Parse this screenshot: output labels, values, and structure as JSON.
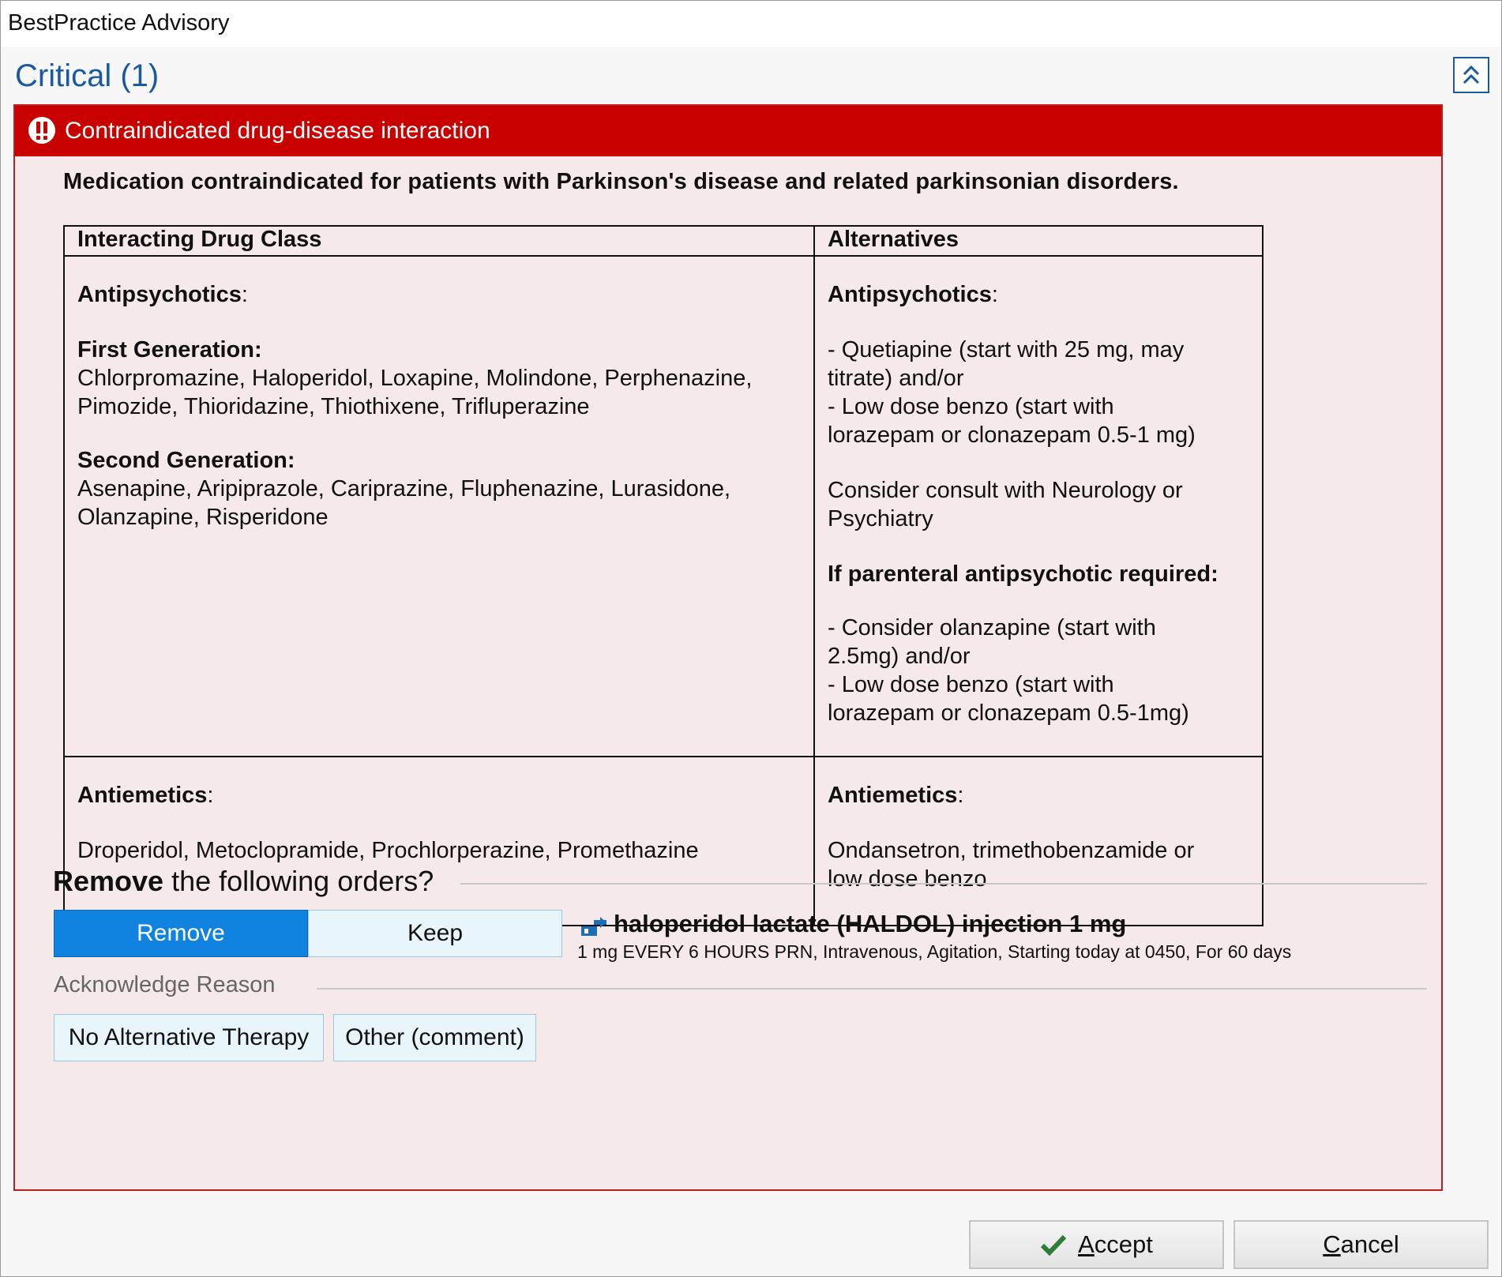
{
  "window": {
    "title": "BestPractice Advisory"
  },
  "section": {
    "title": "Critical (1)"
  },
  "alert": {
    "title": "Contraindicated drug-disease interaction",
    "description": "Medication contraindicated for patients with Parkinson's disease and related parkinsonian disorders."
  },
  "table": {
    "headers": [
      "Interacting Drug Class",
      "Alternatives"
    ],
    "rows": [
      {
        "interacting": {
          "class_label": "Antipsychotics",
          "class_suffix": ":",
          "first_gen_label": "First Generation:",
          "first_gen_line1": "Chlorpromazine, Haloperidol, Loxapine, Molindone, Perphenazine,",
          "first_gen_line2": "Pimozide, Thioridazine, Thiothixene, Trifluperazine",
          "second_gen_label": "Second Generation:",
          "second_gen_line1": "Asenapine, Aripiprazole, Cariprazine, Fluphenazine, Lurasidone,",
          "second_gen_line2": "Olanzapine, Risperidone"
        },
        "alternatives": {
          "class_label": "Antipsychotics",
          "class_suffix": ":",
          "alt1_line1": "- Quetiapine (start with 25 mg, may",
          "alt1_line2": "titrate) and/or",
          "alt2_line1": "- Low dose benzo (start with",
          "alt2_line2": "lorazepam or clonazepam 0.5-1 mg)",
          "consult_line1": "Consider consult with Neurology or",
          "consult_line2": "Psychiatry",
          "parenteral_label": "If parenteral antipsychotic required:",
          "p_alt1_line1": "- Consider olanzapine (start with",
          "p_alt1_line2": "2.5mg) and/or",
          "p_alt2_line1": "- Low dose benzo (start with",
          "p_alt2_line2": "lorazepam or clonazepam 0.5-1mg)"
        }
      },
      {
        "interacting": {
          "class_label": "Antiemetics",
          "class_suffix": ":",
          "drugs": "Droperidol, Metoclopramide, Prochlorperazine, Promethazine"
        },
        "alternatives": {
          "class_label": "Antiemetics",
          "class_suffix": ":",
          "line1": "Ondansetron, trimethobenzamide or",
          "line2": "low dose benzo"
        }
      }
    ]
  },
  "remove_section": {
    "label_bold": "Remove",
    "label_rest": " the following orders?",
    "remove_button": "Remove",
    "keep_button": "Keep",
    "selected": "Remove",
    "order": {
      "icon": "medication-order-icon",
      "name": "haloperidol lactate (HALDOL) injection 1 mg",
      "sig": "1 mg EVERY 6 HOURS PRN, Intravenous, Agitation, Starting today at 0450, For 60 days"
    }
  },
  "acknowledge": {
    "label": "Acknowledge Reason",
    "reasons": [
      "No Alternative Therapy",
      "Other (comment)"
    ]
  },
  "footer": {
    "accept_first": "A",
    "accept_rest": "ccept",
    "cancel_first": "C",
    "cancel_rest": "ancel"
  },
  "colors": {
    "critical_title": "#1b5aa0",
    "alert_header": "#c90000",
    "alert_body": "#f6e9e9",
    "remove_selected": "#1083e0",
    "accept_check": "#2f7d3a"
  }
}
